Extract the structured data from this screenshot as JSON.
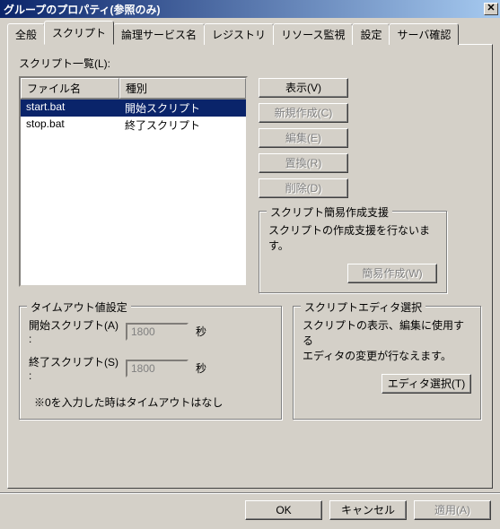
{
  "window": {
    "title": "グループのプロパティ(参照のみ)"
  },
  "tabs": {
    "items": [
      "全般",
      "スクリプト",
      "論理サービス名",
      "レジストリ",
      "リソース監視",
      "設定",
      "サーバ確認"
    ],
    "active_index": 1
  },
  "script_list": {
    "label": "スクリプト一覧(L):",
    "columns": [
      "ファイル名",
      "種別"
    ],
    "rows": [
      {
        "file": "start.bat",
        "type": "開始スクリプト",
        "selected": true
      },
      {
        "file": "stop.bat",
        "type": "終了スクリプト",
        "selected": false
      }
    ]
  },
  "buttons": {
    "show": "表示(V)",
    "new": "新規作成(C)",
    "edit": "編集(E)",
    "replace": "置換(R)",
    "delete": "削除(D)"
  },
  "support": {
    "legend": "スクリプト簡易作成支援",
    "text": "スクリプトの作成支援を行ないます。",
    "button": "簡易作成(W)"
  },
  "timeout": {
    "legend": "タイムアウト値設定",
    "start_label": "開始スクリプト(A) :",
    "end_label": "終了スクリプト(S) :",
    "start_value": "1800",
    "end_value": "1800",
    "unit": "秒",
    "note": "※0を入力した時はタイムアウトはなし"
  },
  "editor": {
    "legend": "スクリプトエディタ選択",
    "text1": "スクリプトの表示、編集に使用する",
    "text2": "エディタの変更が行なえます。",
    "button": "エディタ選択(T)"
  },
  "dialog_buttons": {
    "ok": "OK",
    "cancel": "キャンセル",
    "apply": "適用(A)"
  }
}
